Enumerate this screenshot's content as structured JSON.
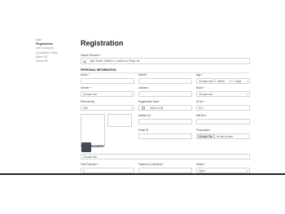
{
  "sidebar": {
    "items": [
      {
        "label": "Mas",
        "active": false
      },
      {
        "label": "Registration",
        "active": true
      },
      {
        "label": "List & Actions",
        "active": false
      },
      {
        "label": "Completed Tests",
        "active": false
      },
      {
        "label": "Mass FB",
        "active": false
      },
      {
        "label": "Show FB",
        "active": false
      }
    ]
  },
  "page": {
    "title": "Registration",
    "search": {
      "label": "Search Records",
      "placeholder": "Type Name, Mobile no, Aadhar or Regd. No"
    },
    "personal_section": "PERSONAL INFORMATION",
    "fields": {
      "name": {
        "label": "Name"
      },
      "mobile": {
        "label": "Mobile"
      },
      "age": {
        "label": "Age",
        "unit": "Choose one",
        "month": "Month",
        "days": "Days"
      },
      "gender": {
        "label": "Gender",
        "value": "Choose one"
      },
      "address": {
        "label": "Address"
      },
      "block": {
        "label": "Block",
        "value": "Choose one"
      },
      "referred_by": {
        "label": "Referred By",
        "value": "Self"
      },
      "registration_date": {
        "label": "Registration Date",
        "value": "2024-04-08"
      },
      "id_no": {
        "label": "ID No.",
        "value": "Dr.Y"
      },
      "aadhar": {
        "label": "Aadhar No"
      },
      "abha": {
        "label": "ABHA Id"
      },
      "email": {
        "label": "Email ID"
      },
      "prescription": {
        "label": "Prescription",
        "button": "Choose File",
        "status": "No file chosen"
      }
    },
    "payment_section": "TEST & PAYMENT",
    "test": {
      "label": "Test(s)",
      "value": "Choose one"
    },
    "total_payment": {
      "label": "Total Payment",
      "value": "0"
    },
    "payment_collected": {
      "label": "Payment (Collected)"
    },
    "status": {
      "label": "Status",
      "value": "Open"
    },
    "required_mark": "*"
  }
}
